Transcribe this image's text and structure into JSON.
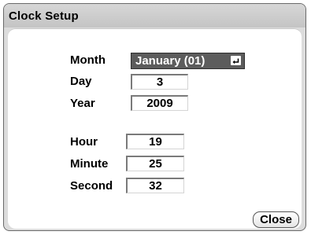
{
  "window": {
    "title": "Clock Setup"
  },
  "date": {
    "month_label": "Month",
    "month_value": "January (01)",
    "day_label": "Day",
    "day_value": "3",
    "year_label": "Year",
    "year_value": "2009"
  },
  "time": {
    "hour_label": "Hour",
    "hour_value": "19",
    "minute_label": "Minute",
    "minute_value": "25",
    "second_label": "Second",
    "second_value": "32"
  },
  "buttons": {
    "close_label": "Close"
  },
  "icons": {
    "dropdown_icon": "enter-arrow-icon"
  }
}
